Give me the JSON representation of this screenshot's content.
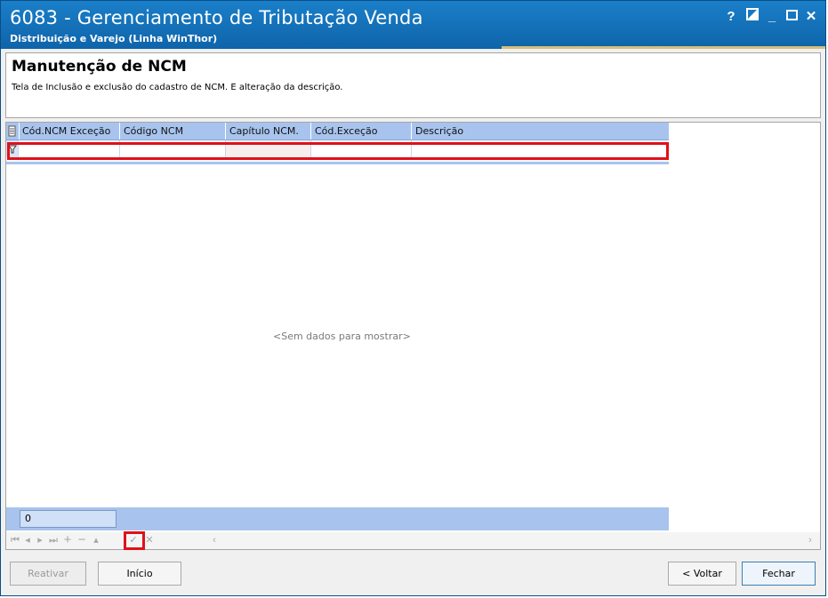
{
  "window": {
    "title": "6083 - Gerenciamento de Tributação Venda",
    "subtitle": "Distribuição e Varejo (Linha WinThor)",
    "controls": {
      "help": "?",
      "restore": "◩",
      "minimize": "_",
      "maximize": "☐",
      "close": "✕"
    }
  },
  "header": {
    "title": "Manutenção de NCM",
    "description": "Tela de Inclusão e exclusão do cadastro de NCM. E alteração da descrição."
  },
  "grid": {
    "columns": [
      "Cód.NCM Exceção",
      "Código NCM",
      "Capítulo NCM.",
      "Cód.Exceção",
      "Descrição"
    ],
    "empty_text": "<Sem dados para mostrar>",
    "record_count": "0"
  },
  "navigator": {
    "buttons": [
      "first",
      "prev",
      "next",
      "last",
      "insert",
      "delete",
      "edit",
      "post",
      "cancel"
    ]
  },
  "buttons": {
    "reativar": "Reativar",
    "inicio": "Início",
    "voltar": "< Voltar",
    "fechar": "Fechar"
  },
  "colors": {
    "title_bar": "#1a7fc9",
    "grid_header": "#a8c4ee",
    "highlight": "#e0101a"
  }
}
